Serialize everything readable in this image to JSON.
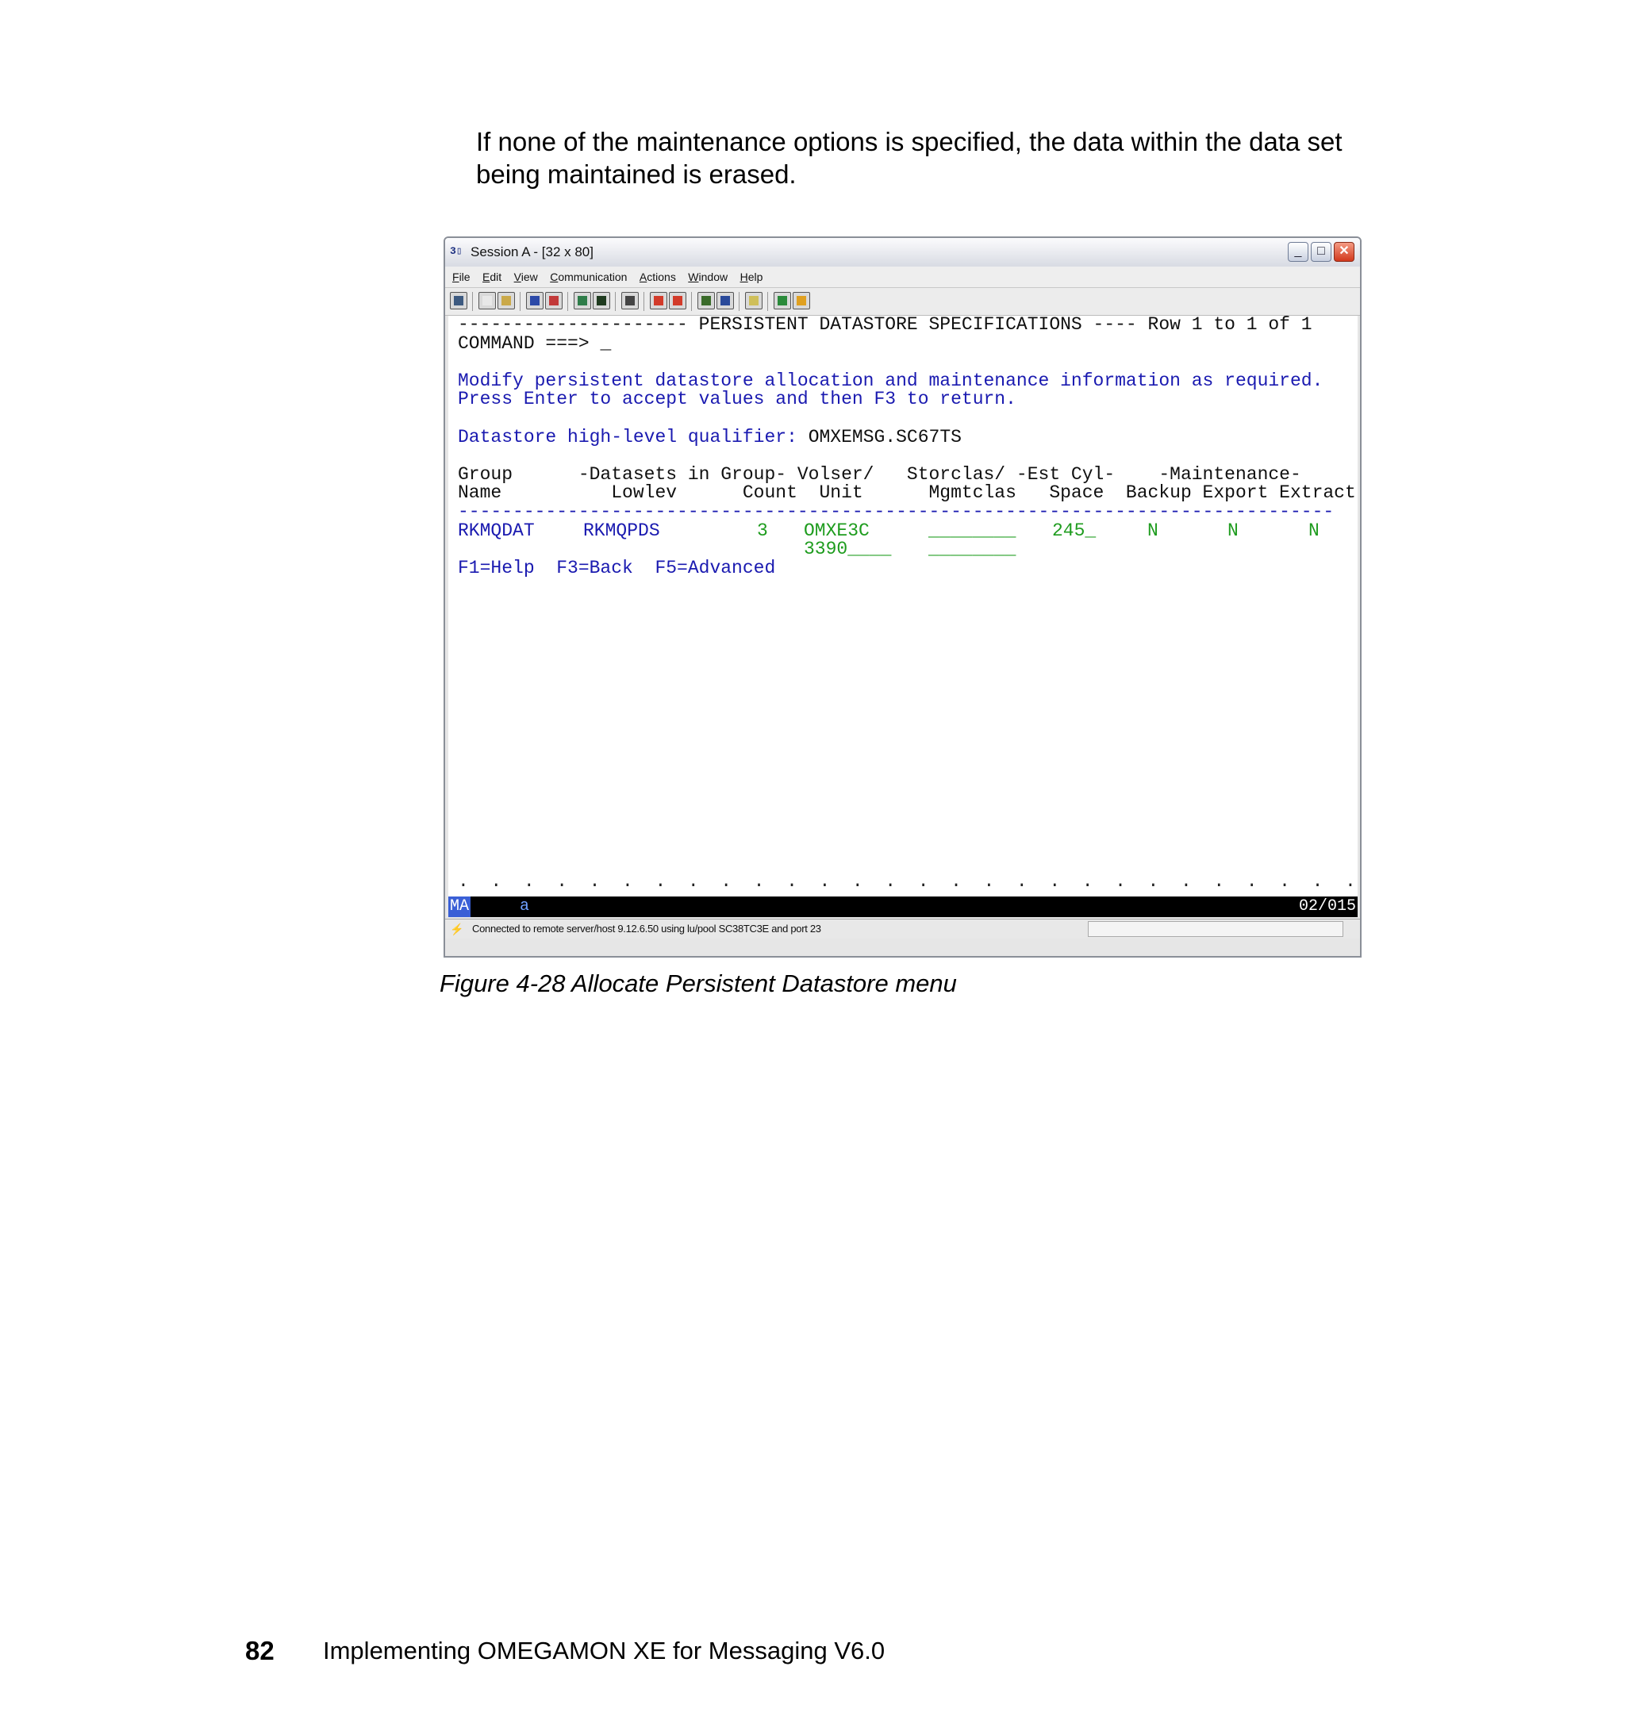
{
  "intro_text": "If none of the maintenance options is specified, the data within the data set being maintained is erased.",
  "window": {
    "title": "Session A - [32 x 80]",
    "menu": [
      "File",
      "Edit",
      "View",
      "Communication",
      "Actions",
      "Window",
      "Help"
    ],
    "controls": {
      "minimize": "_",
      "maximize": "□",
      "close": "✕"
    }
  },
  "terminal": {
    "header_line": "--------------------- PERSISTENT DATASTORE SPECIFICATIONS ---- Row 1 to 1 of 1",
    "command_prompt": "COMMAND ===>",
    "command_value": "_",
    "instruction_1": "Modify persistent datastore allocation and maintenance information as required.",
    "instruction_2": "Press Enter to accept values and then F3 to return.",
    "hlq_label": "Datastore high-level qualifier:",
    "hlq_value": "OMXEMSG.SC67TS",
    "col_header_1": "Group      -Datasets in Group- Volser/   Storclas/ -Est Cyl-    -Maintenance-",
    "col_header_2": "Name          Lowlev      Count  Unit      Mgmtclas   Space  Backup Export Extract",
    "separator": "--------------------------------------------------------------------------------",
    "row": {
      "group_name": "RKMQDAT",
      "lowlev": "RKMQPDS",
      "count": "3",
      "volser": "OMXE3C",
      "unit": "3390____",
      "storclas": "________",
      "mgmtclas": "________",
      "space": "245_",
      "backup": "N",
      "export": "N",
      "extract": "N"
    },
    "fkeys": "F1=Help  F3=Back  F5=Advanced",
    "dots": ".  .  .  .  .  .  .  .  .  .  .  .  .  .  .  .  .  .  .  .  .  .  .  .  .  .  .  ."
  },
  "oia": {
    "mode": "MA",
    "indicator": "a",
    "cursor_pos": "02/015"
  },
  "status": {
    "text": "Connected to remote server/host 9.12.6.50 using lu/pool SC38TC3E and port 23"
  },
  "caption": "Figure 4-28   Allocate Persistent Datastore menu",
  "footer": {
    "page_number": "82",
    "book_title": "Implementing OMEGAMON XE for Messaging V6.0"
  }
}
